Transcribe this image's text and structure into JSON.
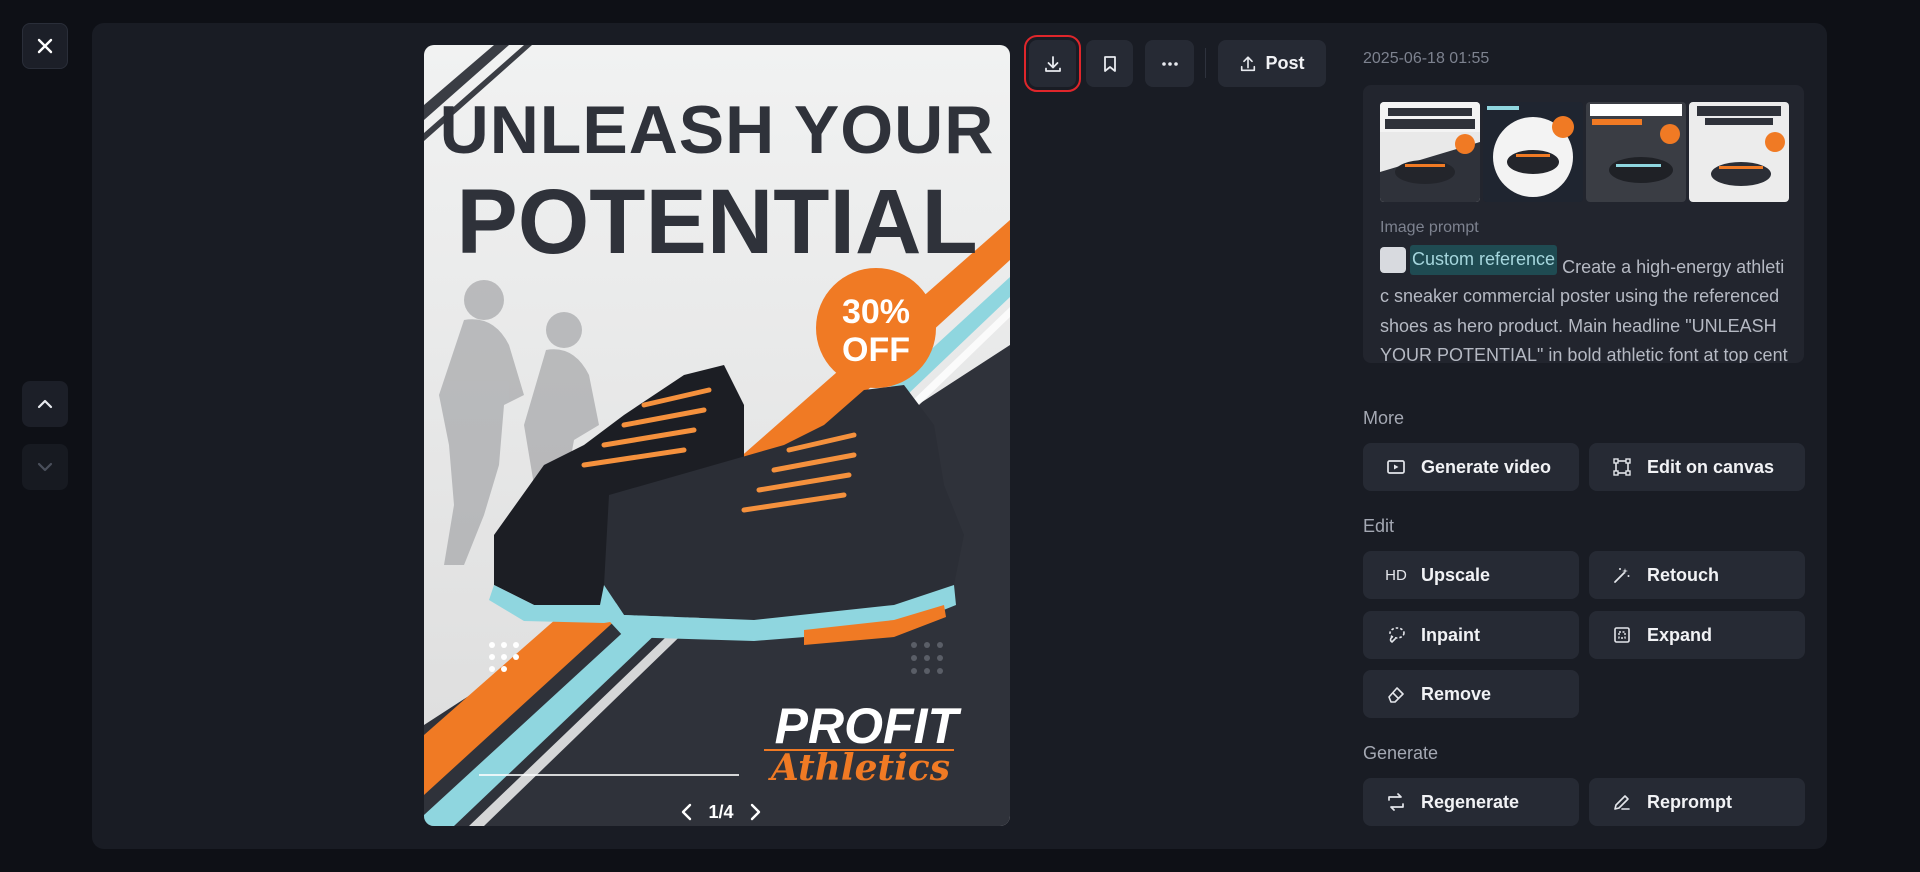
{
  "timestamp": "2025-06-18 01:55",
  "pager": {
    "text": "1/4"
  },
  "toolbar": {
    "post_label": "Post"
  },
  "poster": {
    "headline_line1": "UNLEASH YOUR",
    "headline_line2": "POTENTIAL",
    "badge_line1": "30%",
    "badge_line2": "OFF",
    "brand_line1": "PROFIT",
    "brand_line2": "Athletics"
  },
  "prompt": {
    "label": "Image prompt",
    "reference_label": "Custom reference",
    "text": "Create a high-energy athletic sneaker commercial poster using the referenced shoes as hero product. Main headline \"UNLEASH YOUR POTENTIAL\" in bold athletic font at top cent"
  },
  "sections": {
    "more": "More",
    "edit": "Edit",
    "generate": "Generate"
  },
  "actions": {
    "generate_video": "Generate video",
    "edit_on_canvas": "Edit on canvas",
    "upscale": "Upscale",
    "upscale_icon_text": "HD",
    "retouch": "Retouch",
    "inpaint": "Inpaint",
    "expand": "Expand",
    "remove": "Remove",
    "regenerate": "Regenerate",
    "reprompt": "Reprompt"
  },
  "colors": {
    "accent_orange": "#f07a24",
    "accent_teal": "#8fd6df",
    "highlight_red": "#e0262b"
  },
  "icons": [
    "close-icon",
    "chevron-up-icon",
    "chevron-down-icon",
    "download-icon",
    "bookmark-icon",
    "more-icon",
    "upload-icon",
    "video-plus-icon",
    "canvas-icon",
    "wand-icon",
    "lasso-icon",
    "expand-icon",
    "eraser-icon",
    "refresh-icon",
    "pencil-icon"
  ]
}
